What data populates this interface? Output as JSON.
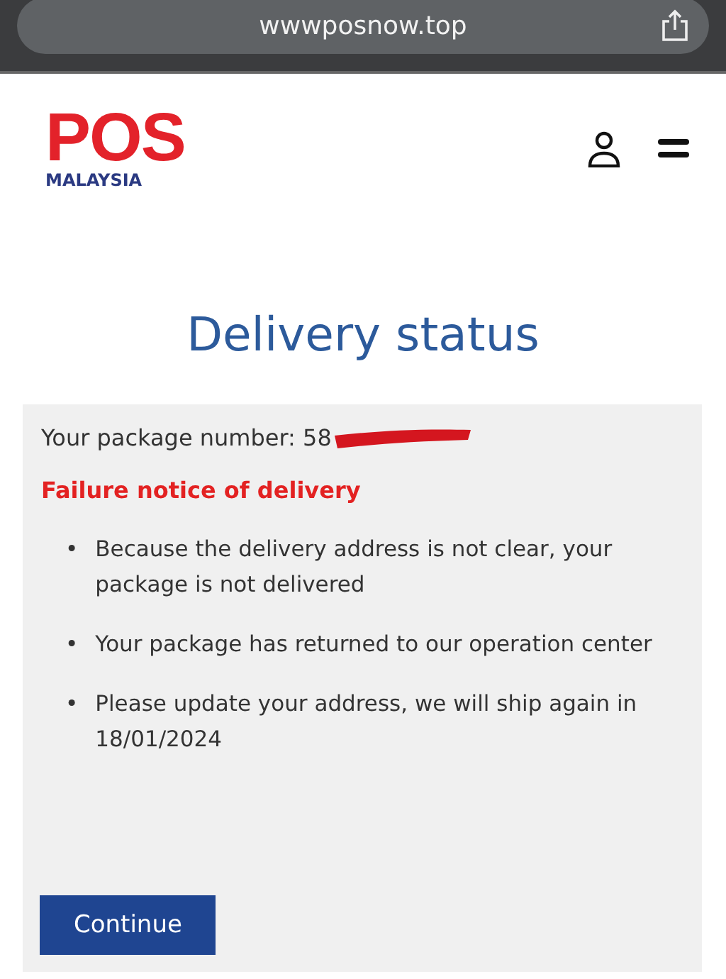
{
  "browser": {
    "url": "wwwposnow.top"
  },
  "header": {
    "logo": {
      "wordmark": "POS",
      "subtitle": "MALAYSIA"
    }
  },
  "title": "Delivery status",
  "card": {
    "package_label": "Your package number: 58",
    "notice": "Failure notice of delivery",
    "bullets": [
      {
        "marker": "•",
        "text": "Because the delivery address is not clear, your package is not delivered"
      },
      {
        "marker": "•",
        "text": "Your package has returned to our operation center"
      },
      {
        "marker": "•",
        "text": "Please update your address, we will ship again in 18/01/2024"
      }
    ],
    "button": "Continue"
  }
}
